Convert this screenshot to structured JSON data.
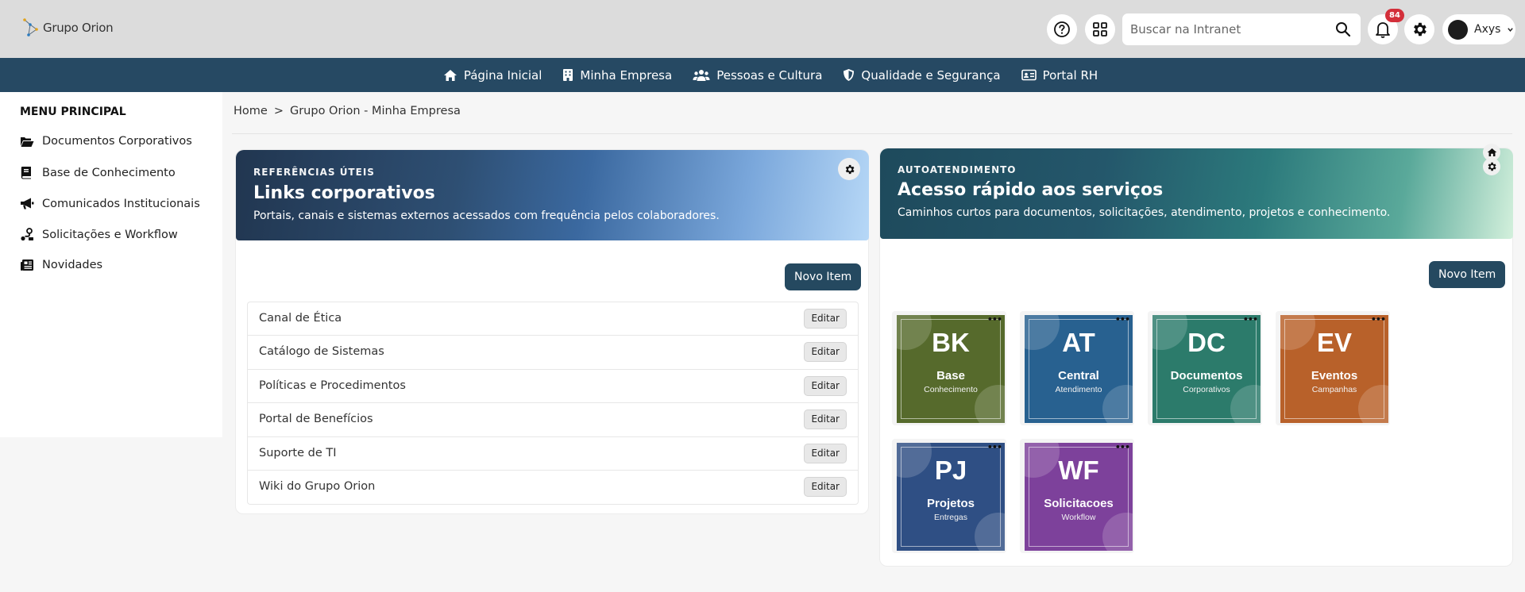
{
  "header": {
    "logo_text": "Grupo Orion",
    "search_placeholder": "Buscar na Intranet",
    "notification_count": "84",
    "user_name": "Axys",
    "icons": [
      "help-icon",
      "apps-grid-icon",
      "search-icon",
      "bell-icon",
      "gear-icon",
      "chevron-down-icon"
    ]
  },
  "nav": {
    "items": [
      {
        "label": "Página Inicial",
        "icon": "home-icon"
      },
      {
        "label": "Minha Empresa",
        "icon": "building-icon"
      },
      {
        "label": "Pessoas e Cultura",
        "icon": "people-icon"
      },
      {
        "label": "Qualidade e Segurança",
        "icon": "shield-icon"
      },
      {
        "label": "Portal RH",
        "icon": "id-card-icon"
      }
    ]
  },
  "sidebar": {
    "title": "MENU PRINCIPAL",
    "items": [
      {
        "label": "Documentos Corporativos",
        "icon": "folder-open-icon"
      },
      {
        "label": "Base de Conhecimento",
        "icon": "book-icon"
      },
      {
        "label": "Comunicados Institucionais",
        "icon": "megaphone-icon"
      },
      {
        "label": "Solicitações e Workflow",
        "icon": "workflow-icon"
      },
      {
        "label": "Novidades",
        "icon": "newspaper-icon"
      }
    ]
  },
  "breadcrumb": {
    "home": "Home",
    "separator": ">",
    "current": "Grupo Orion - Minha Empresa"
  },
  "links_panel": {
    "kicker": "REFERÊNCIAS ÚTEIS",
    "title": "Links corporativos",
    "subtitle": "Portais, canais e sistemas externos acessados com frequência pelos colaboradores.",
    "new_item_label": "Novo Item",
    "edit_label": "Editar",
    "links": [
      "Canal de Ética",
      "Catálogo de Sistemas",
      "Políticas e Procedimentos",
      "Portal de Benefícios",
      "Suporte de TI",
      "Wiki do Grupo Orion"
    ]
  },
  "services_panel": {
    "kicker": "AUTOATENDIMENTO",
    "title": "Acesso rápido aos serviços",
    "subtitle": "Caminhos curtos para documentos, solicitações, atendimento, projetos e conhecimento.",
    "new_item_label": "Novo Item",
    "menu_dots": "•••",
    "tiles": [
      {
        "abbr": "BK",
        "name": "Base",
        "desc": "Conhecimento",
        "color": "#566a2c"
      },
      {
        "abbr": "AT",
        "name": "Central",
        "desc": "Atendimento",
        "color": "#286190"
      },
      {
        "abbr": "DC",
        "name": "Documentos",
        "desc": "Corporativos",
        "color": "#2c7b6b"
      },
      {
        "abbr": "EV",
        "name": "Eventos",
        "desc": "Campanhas",
        "color": "#b8612a"
      },
      {
        "abbr": "PJ",
        "name": "Projetos",
        "desc": "Entregas",
        "color": "#2f4f84"
      },
      {
        "abbr": "WF",
        "name": "Solicitacoes",
        "desc": "Workflow",
        "color": "#7d419b"
      }
    ]
  }
}
